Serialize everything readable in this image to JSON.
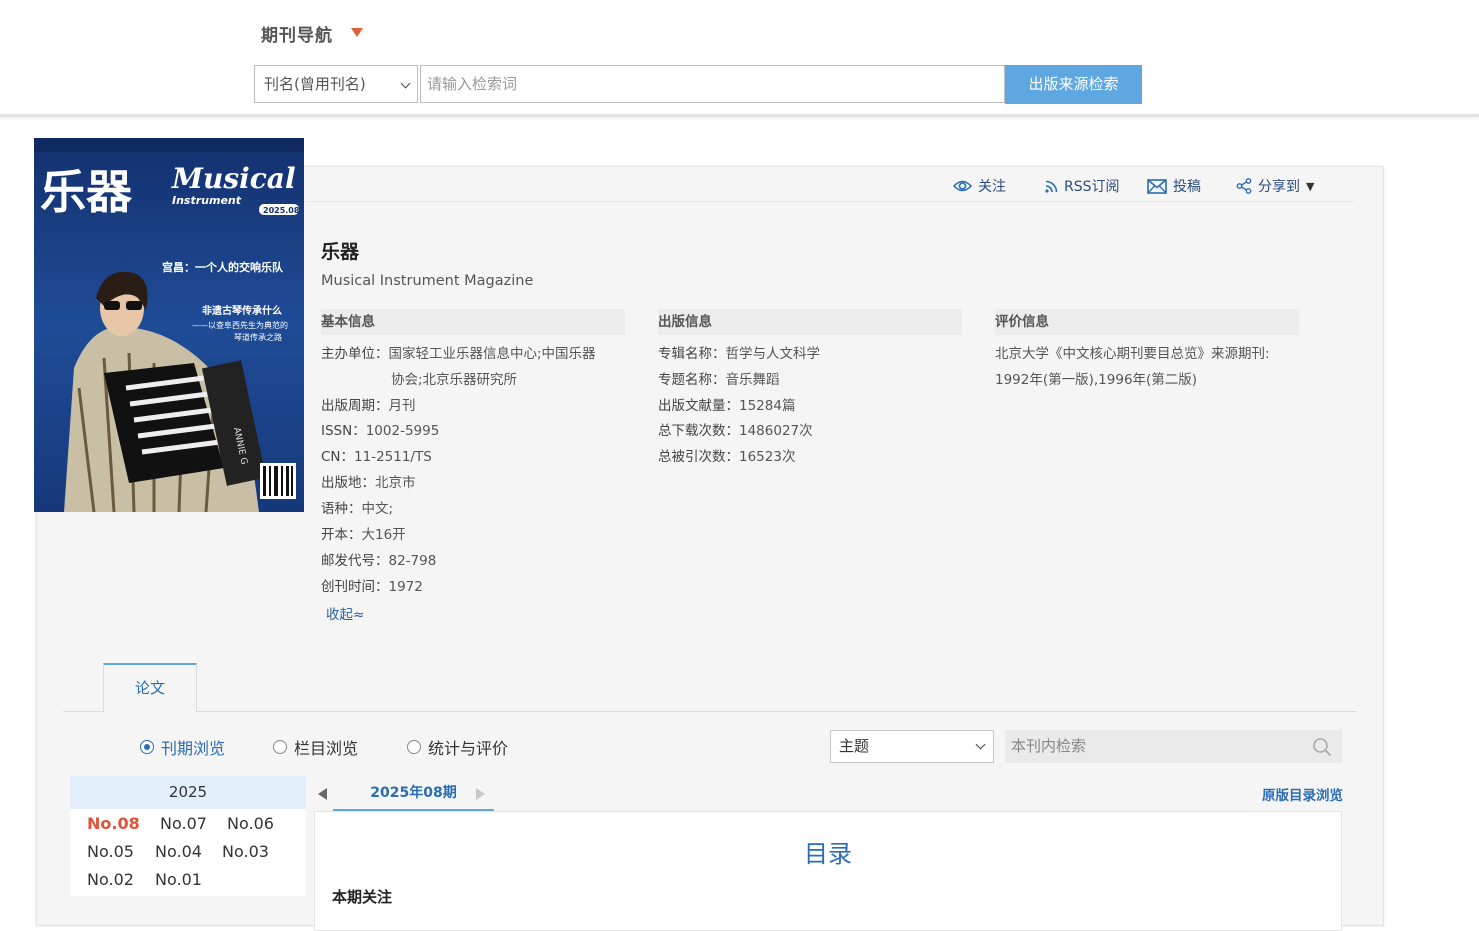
{
  "header": {
    "nav_title": "期刊导航",
    "search_field": "刊名(曾用刊名)",
    "search_placeholder": "请输入检索词",
    "search_button": "出版来源检索"
  },
  "toolbar": {
    "follow": "关注",
    "rss": "RSS订阅",
    "submit": "投稿",
    "share": "分享到"
  },
  "journal": {
    "title": "乐器",
    "subtitle": "Musical Instrument Magazine",
    "cover": {
      "title_cn": "乐器",
      "title_en_1": "Musical",
      "title_en_2": "Instrument",
      "issue": "2025.08",
      "headline_1": "宫昌：一个人的交响乐队",
      "headline_2": "非遗古琴传承什么",
      "headline_3": "——以查阜西先生为典范的",
      "headline_4": "琴道传承之路"
    }
  },
  "basic_info": {
    "heading": "基本信息",
    "sponsor_label": "主办单位：",
    "sponsor_value_1": "国家轻工业乐器信息中心;中国乐器",
    "sponsor_value_2": "协会;北京乐器研究所",
    "period_label": "出版周期：",
    "period_value": "月刊",
    "issn_label": "ISSN：",
    "issn_value": "1002-5995",
    "cn_label": "CN：",
    "cn_value": "11-2511/TS",
    "place_label": "出版地：",
    "place_value": "北京市",
    "lang_label": "语种：",
    "lang_value": "中文;",
    "format_label": "开本：",
    "format_value": "大16开",
    "postal_label": "邮发代号：",
    "postal_value": "82-798",
    "founded_label": "创刊时间：",
    "founded_value": "1972",
    "collapse": "收起≈"
  },
  "pub_info": {
    "heading": "出版信息",
    "album_label": "专辑名称：",
    "album_value": "哲学与人文科学",
    "topic_label": "专题名称：",
    "topic_value": "音乐舞蹈",
    "count_label": "出版文献量：",
    "count_value": "15284篇",
    "downloads_label": "总下载次数：",
    "downloads_value": "1486027次",
    "cited_label": "总被引次数：",
    "cited_value": "16523次"
  },
  "eval_info": {
    "heading": "评价信息",
    "line_1": "北京大学《中文核心期刊要目总览》来源期刊:",
    "line_2": "1992年(第一版),1996年(第二版)"
  },
  "tabs": {
    "paper": "论文"
  },
  "browse": {
    "option_1": "刊期浏览",
    "option_2": "栏目浏览",
    "option_3": "统计与评价",
    "field_select": "主题",
    "inner_search_placeholder": "本刊内检索"
  },
  "years": {
    "year": "2025",
    "issues": [
      "No.08",
      "No.07",
      "No.06",
      "No.05",
      "No.04",
      "No.03",
      "No.02",
      "No.01"
    ]
  },
  "issue_view": {
    "current_issue": "2025年08期",
    "orig_link": "原版目录浏览",
    "toc_title": "目录",
    "section": "本期关注"
  },
  "colors": {
    "accent_blue": "#5ea7e0",
    "link_blue": "#2a6db5",
    "current_issue_red": "#e0533a",
    "nav_caret": "#e0603a"
  }
}
